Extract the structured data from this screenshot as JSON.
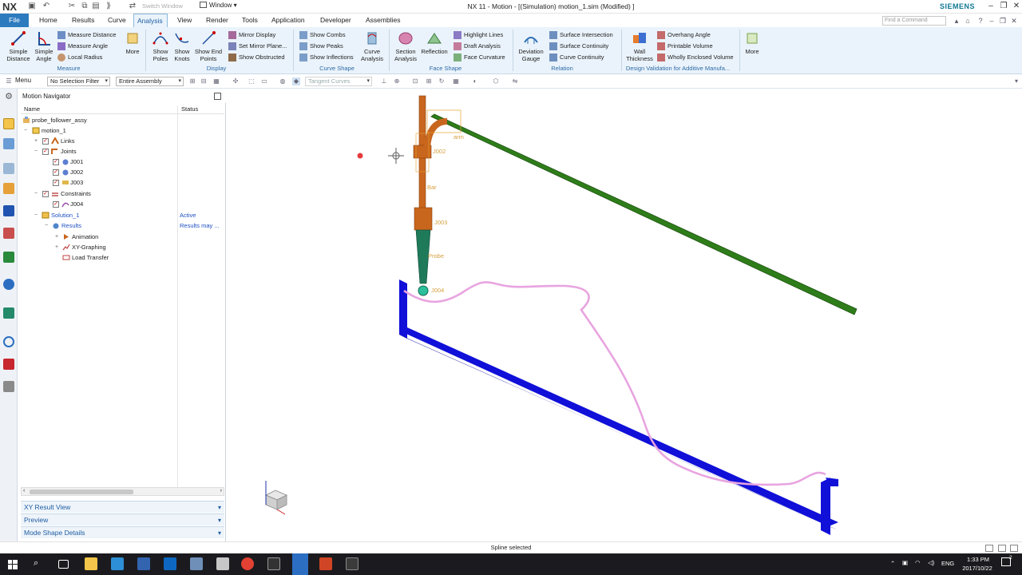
{
  "titlebar": {
    "app_logo": "NX",
    "title": "NX 11 - Motion - [(Simulation) motion_1.sim (Modified) ]",
    "switch_window": "Switch Window",
    "window_menu": "Window",
    "brand": "SIEMENS"
  },
  "menu": {
    "tabs": [
      "File",
      "Home",
      "Results",
      "Curve",
      "Analysis",
      "View",
      "Render",
      "Tools",
      "Application",
      "Developer",
      "Assemblies"
    ],
    "active": "Analysis",
    "find_placeholder": "Find a Command"
  },
  "ribbon": {
    "measure": {
      "simple_distance": "Simple Distance",
      "simple_angle": "Simple Angle",
      "measure_distance": "Measure Distance",
      "measure_angle": "Measure Angle",
      "local_radius": "Local Radius",
      "more": "More",
      "group": "Measure"
    },
    "display": {
      "show_poles": "Show Poles",
      "show_knots": "Show Knots",
      "show_end_points": "Show End Points",
      "mirror_display": "Mirror Display",
      "set_mirror_plane": "Set Mirror Plane...",
      "show_obstructed": "Show Obstructed",
      "group": "Display"
    },
    "curve_shape": {
      "show_combs": "Show Combs",
      "show_peaks": "Show Peaks",
      "show_inflections": "Show Inflections",
      "curve_analysis": "Curve Analysis",
      "group": "Curve Shape"
    },
    "face_shape": {
      "section_analysis": "Section Analysis",
      "reflection": "Reflection",
      "highlight_lines": "Highlight Lines",
      "draft_analysis": "Draft Analysis",
      "face_curvature": "Face Curvature",
      "group": "Face Shape"
    },
    "relation": {
      "deviation_gauge": "Deviation Gauge",
      "surface_intersection": "Surface Intersection",
      "surface_continuity": "Surface Continuity",
      "curve_continuity": "Curve Continuity",
      "group": "Relation"
    },
    "additive": {
      "wall_thickness": "Wall Thickness",
      "overhang_angle": "Overhang Angle",
      "printable_volume": "Printable Volume",
      "wholly_enclosed_volume": "Wholly Enclosed Volume",
      "group": "Design Validation for Additive Manufa..."
    },
    "more": "More"
  },
  "toolbar2": {
    "menu": "Menu",
    "selection_filter": "No Selection Filter",
    "scope": "Entire Assembly",
    "curve_rule": "Tangent Curves"
  },
  "navigator": {
    "title": "Motion Navigator",
    "col_name": "Name",
    "col_status": "Status",
    "rows": [
      {
        "label": "probe_follower_assy",
        "status": ""
      },
      {
        "label": "motion_1",
        "status": ""
      },
      {
        "label": "Links",
        "status": ""
      },
      {
        "label": "Joints",
        "status": ""
      },
      {
        "label": "J001",
        "status": ""
      },
      {
        "label": "J002",
        "status": ""
      },
      {
        "label": "J003",
        "status": ""
      },
      {
        "label": "Constraints",
        "status": ""
      },
      {
        "label": "J004",
        "status": ""
      },
      {
        "label": "Solution_1",
        "status": "Active"
      },
      {
        "label": "Results",
        "status": "Results may ..."
      },
      {
        "label": "Animation",
        "status": ""
      },
      {
        "label": "XY-Graphing",
        "status": ""
      },
      {
        "label": "Load Transfer",
        "status": ""
      }
    ],
    "sections": [
      "XY Result View",
      "Preview",
      "Mode Shape Details"
    ]
  },
  "model_labels": {
    "arm": "arm",
    "j002": "J002",
    "bar": "Bar",
    "j003": "J003",
    "probe": "Probe",
    "j004": "J004"
  },
  "colors": {
    "ribbon_bg": "#eaf3fb",
    "file_tab": "#2d7bbf",
    "bar_orange": "#c8661e",
    "arm_green": "#2e7d1a",
    "frame_blue": "#1010d8",
    "spline_pink": "#e8a4e0",
    "probe_teal": "#1f7a5a"
  },
  "status": {
    "message": "Spline selected"
  },
  "taskbar": {
    "time": "1:33 PM",
    "date": "2017/10/22",
    "lang": "ENG",
    "notifications": "2"
  }
}
